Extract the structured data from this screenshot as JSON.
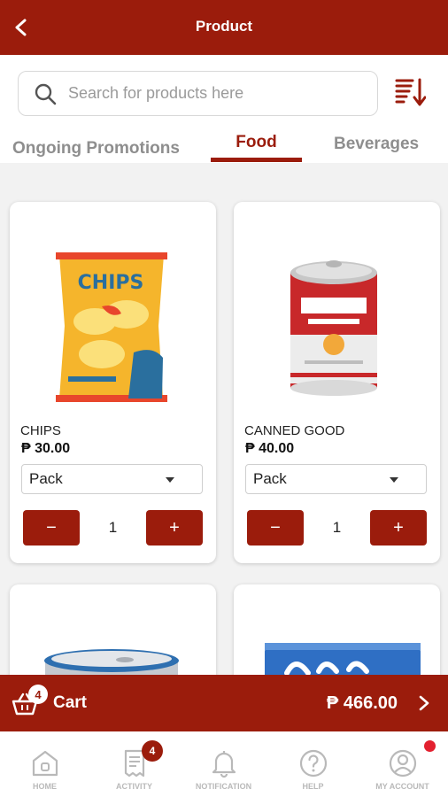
{
  "header": {
    "title": "Product"
  },
  "search": {
    "placeholder": "Search for products here"
  },
  "tabs": [
    {
      "label": "Ongoing Promotions",
      "active": false
    },
    {
      "label": "Food",
      "active": true
    },
    {
      "label": "Beverages",
      "active": false
    }
  ],
  "products": [
    {
      "name": "CHIPS",
      "price": "₱ 30.00",
      "unit": "Pack",
      "quantity": "1",
      "image_icon": "chips-bag-icon"
    },
    {
      "name": "CANNED GOOD",
      "price": "₱ 40.00",
      "unit": "Pack",
      "quantity": "1",
      "image_icon": "canned-good-icon"
    },
    {
      "image_icon": "tin-can-icon"
    },
    {
      "image_icon": "biscuits-pack-icon"
    }
  ],
  "qty_controls": {
    "minus": "−",
    "plus": "+"
  },
  "cart": {
    "label": "Cart",
    "count": "4",
    "total": "₱ 466.00"
  },
  "nav": {
    "items": [
      {
        "label": "HOME",
        "icon": "home-icon"
      },
      {
        "label": "ACTIVITY",
        "icon": "receipt-icon",
        "badge": "4"
      },
      {
        "label": "NOTIFICATION",
        "icon": "bell-icon"
      },
      {
        "label": "HELP",
        "icon": "help-icon"
      },
      {
        "label": "MY ACCOUNT",
        "icon": "account-icon"
      }
    ]
  },
  "colors": {
    "brand": "#9b1c0c",
    "accent_dot": "#e3202f"
  }
}
